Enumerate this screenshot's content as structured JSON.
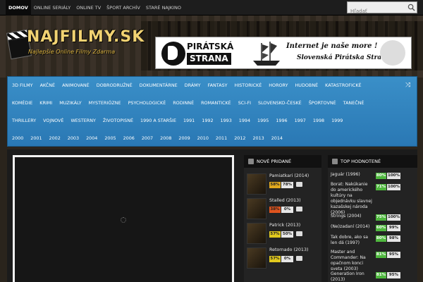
{
  "topnav": {
    "items": [
      "DOMOV",
      "ONLINE SERIÁLY",
      "ONLINE TV",
      "ŠPORT ARCHÍV",
      "STARÉ NAJKINO"
    ],
    "search_placeholder": "Hľadať"
  },
  "logo": {
    "text": "NAJFILMY.SK",
    "subtitle": "Najlepšie Online Filmy Zdarma"
  },
  "banner": {
    "party_line1": "PIRÁTSKÁ",
    "party_line2": "STRANA",
    "tagline1": "Internet je naše more !",
    "tagline2": "Slovenská Pirátska Strana"
  },
  "genres": {
    "row1": [
      "3D FILMY",
      "AKČNÉ",
      "ANIMOVANÉ",
      "DOBRODRUŽNÉ",
      "DOKUMENTÁRNE",
      "DRÁMY",
      "FANTASY",
      "HISTORICKÉ",
      "HORORY",
      "HUDOBNÉ",
      "KATASTROFICKÉ"
    ],
    "row2": [
      "KOMÉDIE",
      "KRIMI",
      "MUZIKÁLY",
      "MYSTERIÓZNE",
      "PSYCHOLOGICKÉ",
      "RODINNÉ",
      "ROMANTICKÉ",
      "SCI-FI",
      "SLOVENSKO-ČESKÉ",
      "ŠPORTOVNÉ",
      "TANEČNÉ"
    ],
    "row3": [
      "THRILLERY",
      "VOJNOVÉ",
      "WESTERNY",
      "ŽIVOTOPISNÉ",
      "1990 A STARŠIE",
      "1991",
      "1992",
      "1993",
      "1994",
      "1995",
      "1996",
      "1997",
      "1998",
      "1999"
    ],
    "row4": [
      "2000",
      "2001",
      "2002",
      "2003",
      "2004",
      "2005",
      "2006",
      "2007",
      "2008",
      "2009",
      "2010",
      "2011",
      "2012",
      "2013",
      "2014"
    ]
  },
  "new_panel": {
    "title": "NOVÉ PRIDANÉ",
    "items": [
      {
        "title": "Pamiatkari (2014)",
        "pct": "58%",
        "likes": "78%",
        "color": "#e0a81e"
      },
      {
        "title": "Stalled (2013)",
        "pct": "38%",
        "likes": "0%",
        "color": "#e0541e"
      },
      {
        "title": "Patrick (2013)",
        "pct": "57%",
        "likes": "50%",
        "color": "#e0c81e"
      },
      {
        "title": "Retornado (2013)",
        "pct": "57%",
        "likes": "0%",
        "color": "#e0c81e"
      }
    ]
  },
  "top_panel": {
    "title": "TOP HODNOTENÉ",
    "items": [
      {
        "title": "Jaguár (1996)",
        "pct": "80%",
        "likes": "100%"
      },
      {
        "title": "Borat: Nakúkanie do amerického kultúry na objednávku slavnej kazašskej národa (2006)",
        "pct": "71%",
        "likes": "100%"
      },
      {
        "title": "Strings (2004)",
        "pct": "75%",
        "likes": "100%"
      },
      {
        "title": "(Ne)zadaní (2014)",
        "pct": "60%",
        "likes": "99%"
      },
      {
        "title": "Tak dobre, ako sa len dá (1997)",
        "pct": "80%",
        "likes": "98%"
      },
      {
        "title": "Master and Commander: Na opačnom konci sveta (2003)",
        "pct": "81%",
        "likes": "95%"
      },
      {
        "title": "Generation Iron (2013)",
        "pct": "81%",
        "likes": "95%"
      }
    ]
  }
}
